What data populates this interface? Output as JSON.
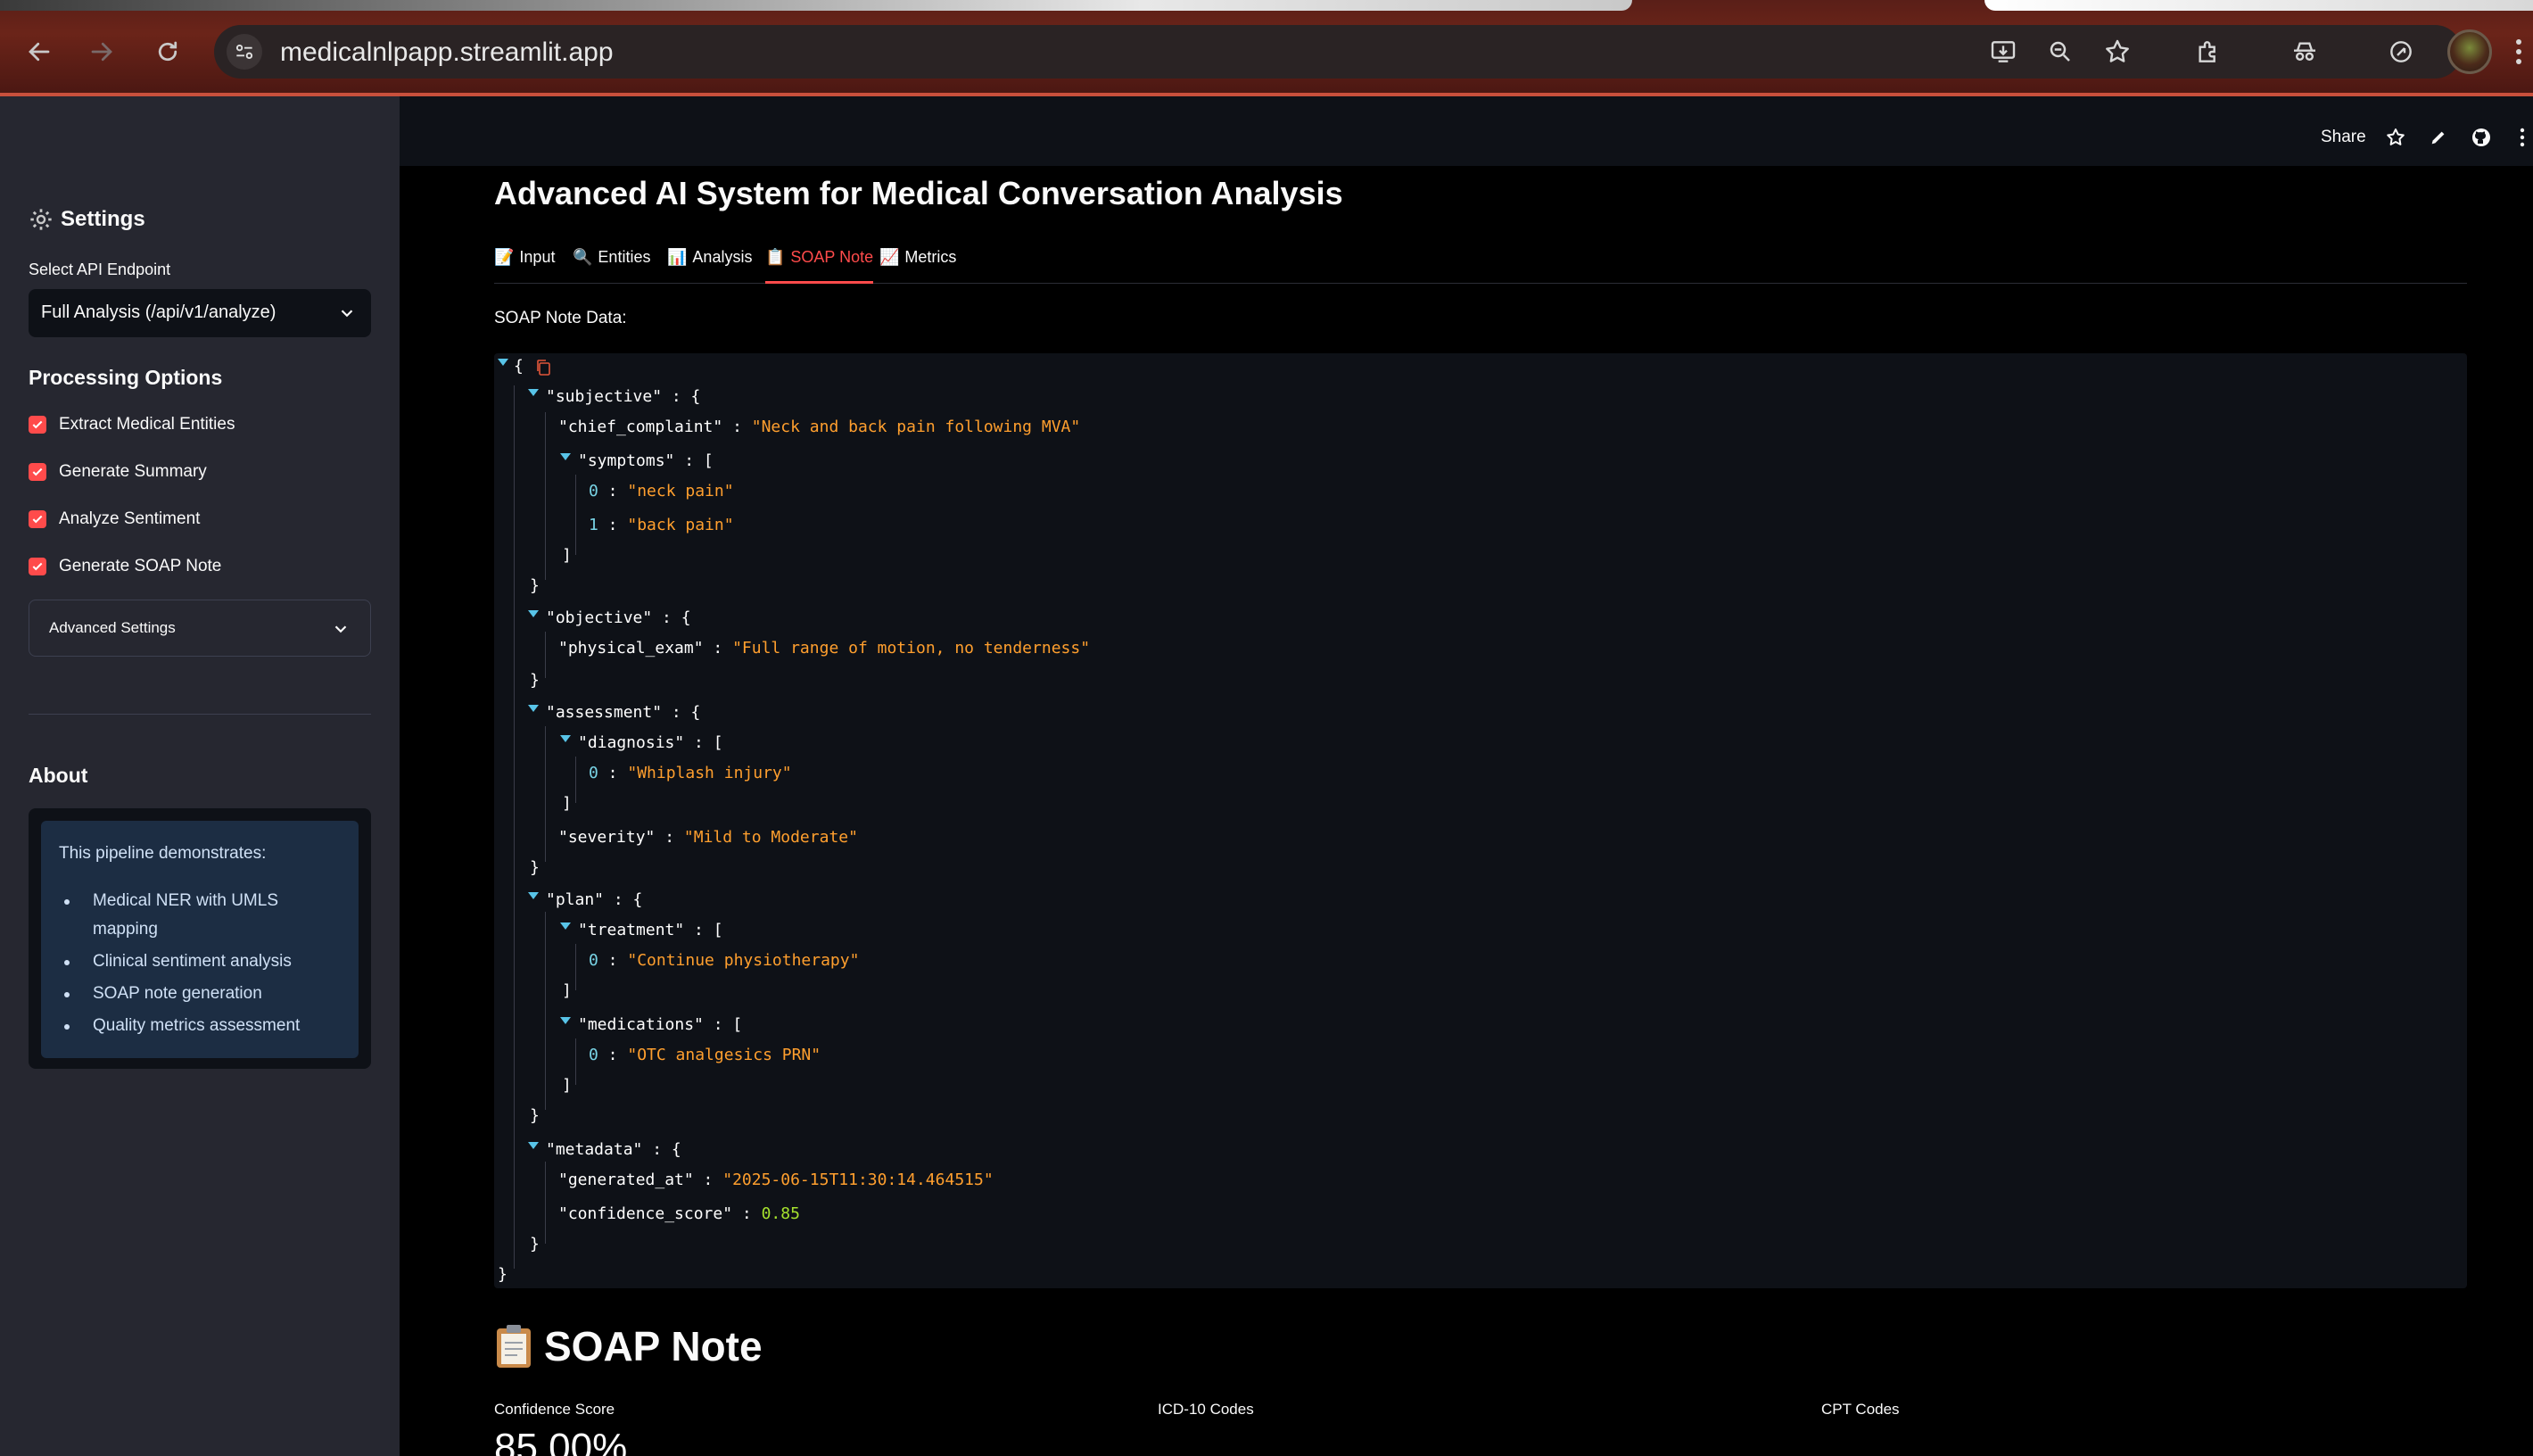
{
  "browser": {
    "url": "medicalnlpapp.streamlit.app"
  },
  "header": {
    "share_label": "Share"
  },
  "sidebar": {
    "title": "Settings",
    "endpoint_label": "Select API Endpoint",
    "endpoint_value": "Full Analysis (/api/v1/analyze)",
    "processing_title": "Processing Options",
    "options": [
      {
        "label": "Extract Medical Entities",
        "checked": true
      },
      {
        "label": "Generate Summary",
        "checked": true
      },
      {
        "label": "Analyze Sentiment",
        "checked": true
      },
      {
        "label": "Generate SOAP Note",
        "checked": true
      }
    ],
    "advanced_label": "Advanced Settings",
    "about_title": "About",
    "about_intro": "This pipeline demonstrates:",
    "about_items": [
      "Medical NER with UMLS mapping",
      "Clinical sentiment analysis",
      "SOAP note generation",
      "Quality metrics assessment"
    ]
  },
  "main": {
    "title": "Advanced AI System for Medical Conversation Analysis",
    "tabs": [
      {
        "icon": "📝",
        "label": "Input"
      },
      {
        "icon": "🔍",
        "label": "Entities"
      },
      {
        "icon": "📊",
        "label": "Analysis"
      },
      {
        "icon": "📋",
        "label": "SOAP Note"
      },
      {
        "icon": "📈",
        "label": "Metrics"
      }
    ],
    "active_tab": "SOAP Note",
    "soap_data_label": "SOAP Note Data:",
    "json": {
      "k_subjective": "\"subjective\"",
      "k_chief": "\"chief_complaint\"",
      "v_chief": "\"Neck and back pain following MVA\"",
      "k_symptoms": "\"symptoms\"",
      "v_sym0": "\"neck pain\"",
      "v_sym1": "\"back pain\"",
      "k_objective": "\"objective\"",
      "k_physical": "\"physical_exam\"",
      "v_physical": "\"Full range of motion, no tenderness\"",
      "k_assessment": "\"assessment\"",
      "k_diagnosis": "\"diagnosis\"",
      "v_diag0": "\"Whiplash injury\"",
      "k_severity": "\"severity\"",
      "v_severity": "\"Mild to Moderate\"",
      "k_plan": "\"plan\"",
      "k_treatment": "\"treatment\"",
      "v_treat0": "\"Continue physiotherapy\"",
      "k_medications": "\"medications\"",
      "v_med0": "\"OTC analgesics PRN\"",
      "k_metadata": "\"metadata\"",
      "k_generated": "\"generated_at\"",
      "v_generated": "\"2025-06-15T11:30:14.464515\"",
      "k_confidence": "\"confidence_score\"",
      "v_confidence": "0.85"
    },
    "soap_heading": "SOAP Note",
    "metrics": [
      {
        "label": "Confidence Score",
        "value": "85.00%"
      },
      {
        "label": "ICD-10 Codes",
        "value": ""
      },
      {
        "label": "CPT Codes",
        "value": ""
      }
    ]
  },
  "colors": {
    "accent": "#ff4b4b",
    "sidebar_bg": "#262730",
    "json_string": "#ff9f2e",
    "json_number": "#a6e22e",
    "about_bg": "#1c2d43"
  }
}
